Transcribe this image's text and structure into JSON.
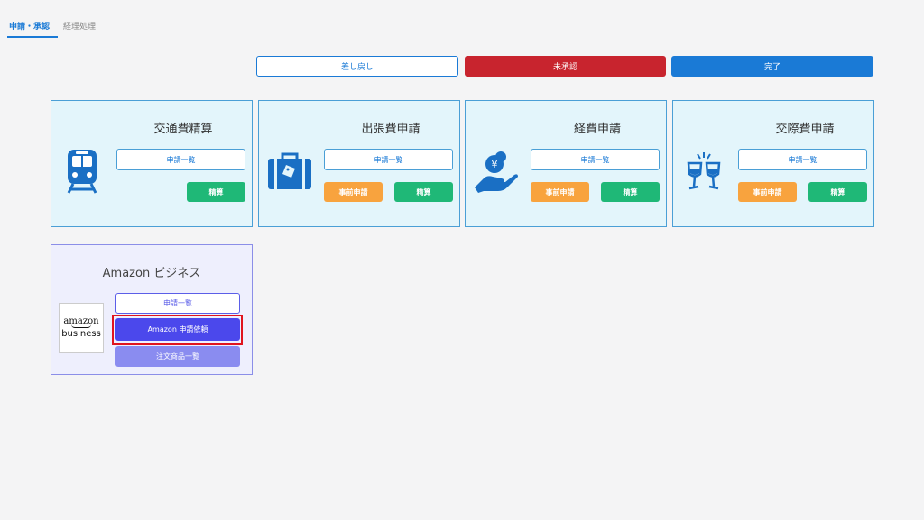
{
  "tabs": {
    "active": "申請・承認",
    "inactive": "経理処理"
  },
  "status_buttons": {
    "returned": "差し戻し",
    "unapproved": "未承認",
    "done": "完了"
  },
  "cards": [
    {
      "title": "交通費精算",
      "icon": "train-icon",
      "list_label": "申請一覧",
      "settle_label": "精算"
    },
    {
      "title": "出張費申請",
      "icon": "suitcase-icon",
      "list_label": "申請一覧",
      "prior_label": "事前申請",
      "settle_label": "精算"
    },
    {
      "title": "経費申請",
      "icon": "yen-coin-hand-icon",
      "list_label": "申請一覧",
      "prior_label": "事前申請",
      "settle_label": "精算"
    },
    {
      "title": "交際費申請",
      "icon": "wine-glasses-icon",
      "list_label": "申請一覧",
      "prior_label": "事前申請",
      "settle_label": "精算"
    }
  ],
  "amazon": {
    "title": "Amazon ビジネス",
    "logo_line1": "amazon",
    "logo_line2": "business",
    "list_label": "申請一覧",
    "request_label": "Amazon 申請依頼",
    "orders_label": "注文商品一覧"
  },
  "colors": {
    "accent": "#1a7ad6",
    "danger": "#c8242e",
    "settle": "#1fb877",
    "prior": "#f8a33e",
    "amazon_primary": "#4b48ec",
    "highlight": "#e0141e"
  }
}
